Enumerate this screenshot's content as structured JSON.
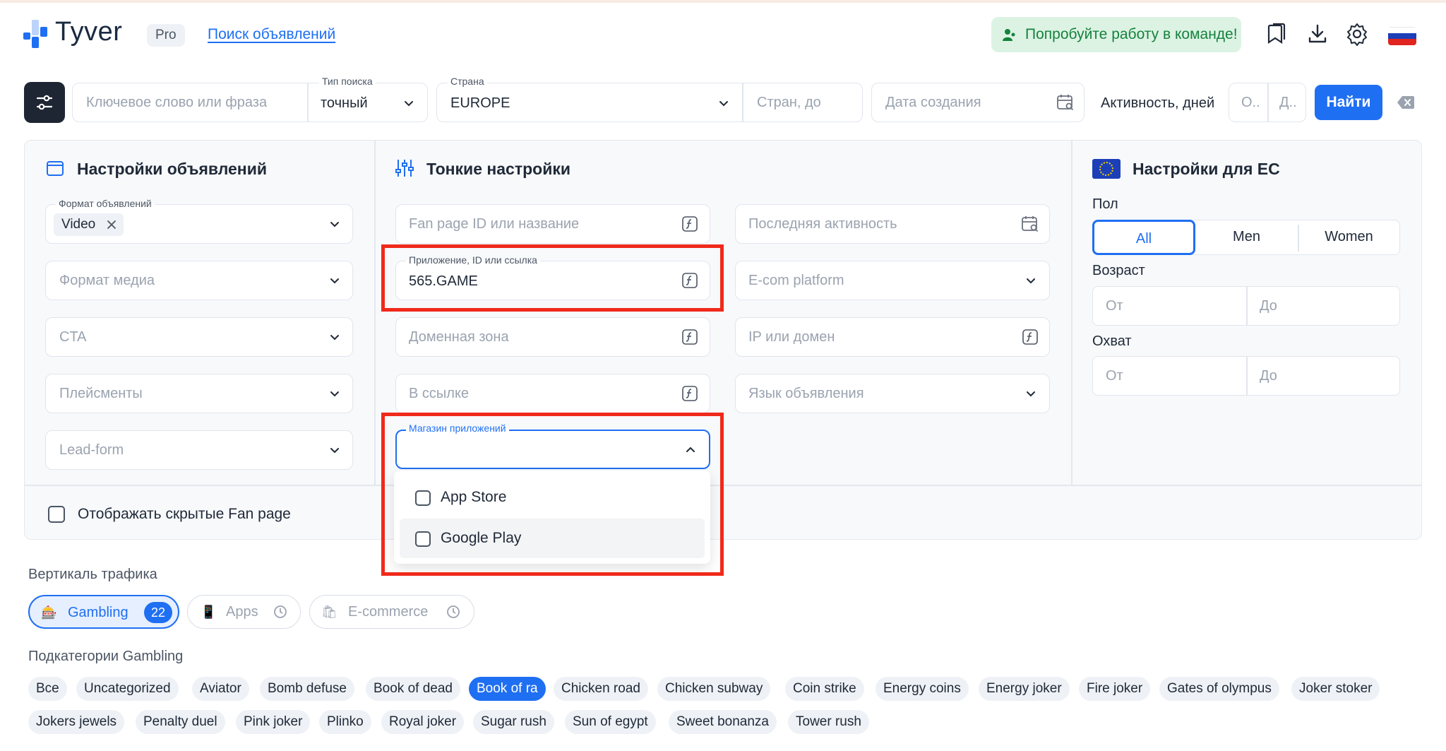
{
  "header": {
    "brand": "Tyver",
    "plan_badge": "Pro",
    "nav_link": "Поиск объявлений",
    "team_button": "Попробуйте работу в команде!"
  },
  "search": {
    "keyword_placeholder": "Ключевое слово или фраза",
    "search_type_label": "Тип поиска",
    "search_type_value": "точный",
    "country_label": "Страна",
    "country_value": "EUROPE",
    "countries_to_placeholder": "Стран, до",
    "created_date_placeholder": "Дата создания",
    "activity_label": "Активность, дней",
    "activity_from_placeholder": "О..",
    "activity_to_placeholder": "Д..",
    "find_button": "Найти"
  },
  "ad_settings": {
    "title": "Настройки объявлений",
    "ad_format_label": "Формат объявлений",
    "ad_format_chip": "Video",
    "media_format": "Формат медиа",
    "cta": "CTA",
    "placements": "Плейсменты",
    "lead_form": "Lead-form"
  },
  "fine_settings": {
    "title": "Тонкие настройки",
    "fan_page": "Fan page ID или название",
    "app_label": "Приложение, ID или ссылка",
    "app_value": "565.GAME",
    "domain_zone": "Доменная зона",
    "in_link": "В ссылке",
    "app_store_label": "Магазин приложений",
    "app_store_options": [
      "App Store",
      "Google Play"
    ],
    "last_activity": "Последняя активность",
    "ecom_platform": "E-com platform",
    "ip_domain": "IP или домен",
    "ad_language": "Язык объявления"
  },
  "eu_settings": {
    "title": "Настройки для ЕС",
    "gender_label": "Пол",
    "gender_options": [
      "All",
      "Men",
      "Women"
    ],
    "gender_selected": "All",
    "age_label": "Возраст",
    "reach_label": "Охват",
    "from_placeholder": "От",
    "to_placeholder": "До"
  },
  "show_hidden_fan_pages": "Отображать скрытые Fan page",
  "traffic": {
    "label": "Вертикаль трафика",
    "verticals": [
      {
        "label": "Gambling",
        "count": "22"
      },
      {
        "label": "Apps"
      },
      {
        "label": "E-commerce"
      }
    ]
  },
  "subcategories": {
    "label": "Подкатегории Gambling",
    "selected": "Book of ra",
    "row1": [
      "Все",
      "Uncategorized",
      "Aviator",
      "Bomb defuse",
      "Book of dead",
      "Book of ra",
      "Chicken road",
      "Chicken subway",
      "Coin strike",
      "Energy coins",
      "Energy joker",
      "Fire joker",
      "Gates of olympus",
      "Joker stoker"
    ],
    "row2": [
      "Jokers jewels",
      "Penalty duel",
      "Pink joker",
      "Plinko",
      "Royal joker",
      "Sugar rush",
      "Sun of egypt",
      "Sweet bonanza",
      "Tower rush"
    ]
  },
  "colors": {
    "accent": "#1f6ff2",
    "highlight": "#f02a1b",
    "team_bg": "#dcf3e4",
    "team_text": "#16823c",
    "dark_button": "#1f2633"
  }
}
